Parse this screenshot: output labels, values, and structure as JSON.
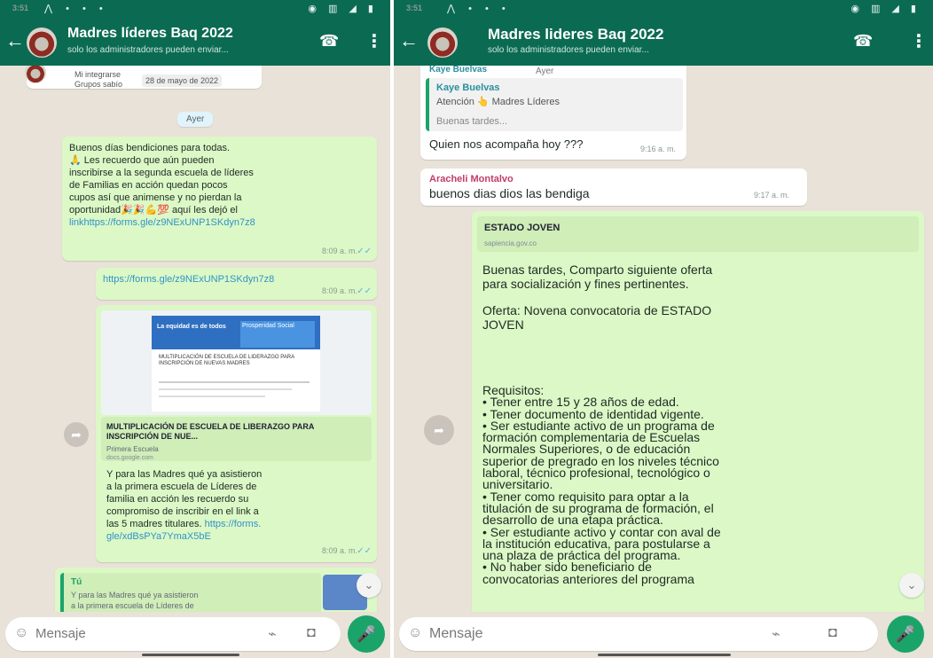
{
  "left": {
    "status": {
      "time": "3:51"
    },
    "header": {
      "title": "Madres líderes Baq 2022",
      "subtitle": "solo los administradores pueden enviar..."
    },
    "top_notice": {
      "line1": "Mi integrarse",
      "line2": "Grupos sabío",
      "chip": "28 de mayo de 2022"
    },
    "date_chip": "Ayer",
    "msg1": {
      "lines": [
        "Buenos días bendiciones para todas.",
        "🙏 Les recuerdo que aún pueden",
        "inscribirse a la segunda escuela de líderes",
        "de Familias en acción quedan pocos",
        "cupos así que animense y no pierdan la",
        "oportunidad🎉🎉💪💯 aquí les dejó el",
        "linkhttps://forms.gle/z9NExUNP1SKdyn7z8"
      ],
      "time": "8:09 a. m."
    },
    "msg2": {
      "link": "https://forms.gle/z9NExUNP1SKdyn7z8",
      "time": "8:09 a. m."
    },
    "msg3": {
      "preview_title": "La equidad es de todos",
      "preview_badge": "Prosperidad Social",
      "preview_text": "MULTIPLICACIÓN DE ESCUELA DE LIDERAZGO PARA INSCRIPCIÓN DE NUEVAS MADRES",
      "link_title": "MULTIPLICACIÓN DE ESCUELA DE LIBERAZGO PARA INSCRIPCIÓN DE NUE...",
      "link_sub": "Primera Escuela",
      "link_domain": "docs.google.com",
      "lines": [
        "Y para las Madres qué ya asistieron",
        "a la primera escuela de Líderes de",
        "familia en acción les recuerdo su",
        "compromiso de inscribir en el link a",
        "las 5 madres titulares."
      ],
      "link_tail1": "https://forms.",
      "link_tail2": "gle/xdBsPYa7YmaX5bE",
      "time": "8:09 a. m."
    },
    "reply": {
      "author": "Tú",
      "line1": "Y para las Madres qué ya asistieron",
      "line2": "a la primera escuela de Líderes de"
    },
    "input": {
      "placeholder": "Mensaje"
    }
  },
  "right": {
    "status": {
      "time": "3:51"
    },
    "header": {
      "title": "Madres lideres Baq 2022",
      "subtitle": "solo los administradores pueden enviar..."
    },
    "msg1": {
      "author_top": "Kaye Buelvas",
      "ayer": "Ayer",
      "quote_author": "Kaye Buelvas",
      "quote_line1": "Atención 👆 Madres Líderes",
      "quote_line2": "Buenas tardes...",
      "text": "Quien nos acompaña hoy ???",
      "time": "9:16 a. m."
    },
    "msg2": {
      "author": "Aracheli Montalvo",
      "text": "buenos dias dios las bendiga",
      "time": "9:17 a. m."
    },
    "msg3": {
      "link_title": "ESTADO JOVEN",
      "link_domain": "sapiencia.gov.co",
      "p1": [
        "Buenas tardes, Comparto  siguiente oferta",
        "para socialización y fines pertinentes."
      ],
      "p2": [
        "Oferta: Novena convocatoria de ESTADO",
        "JOVEN"
      ],
      "req": [
        "Requisitos:",
        "• Tener entre 15 y 28 años de edad.",
        "• Tener documento de identidad vigente.",
        "• Ser estudiante activo de un programa de",
        "formación complementaria de Escuelas",
        "Normales Superiores, o de educación",
        "superior de pregrado en los niveles técnico",
        "laboral, técnico profesional, tecnológico o",
        "universitario.",
        "• Tener como requisito para optar a la",
        "titulación de su programa de formación, el",
        "desarrollo de una etapa práctica.",
        "• Ser estudiante activo y contar con aval de",
        "la institución educativa, para postularse a",
        "una plaza de práctica del programa.",
        "• No haber sido beneficiario de",
        "convocatorias anteriores del programa"
      ]
    },
    "input": {
      "placeholder": "Mensaje"
    }
  }
}
